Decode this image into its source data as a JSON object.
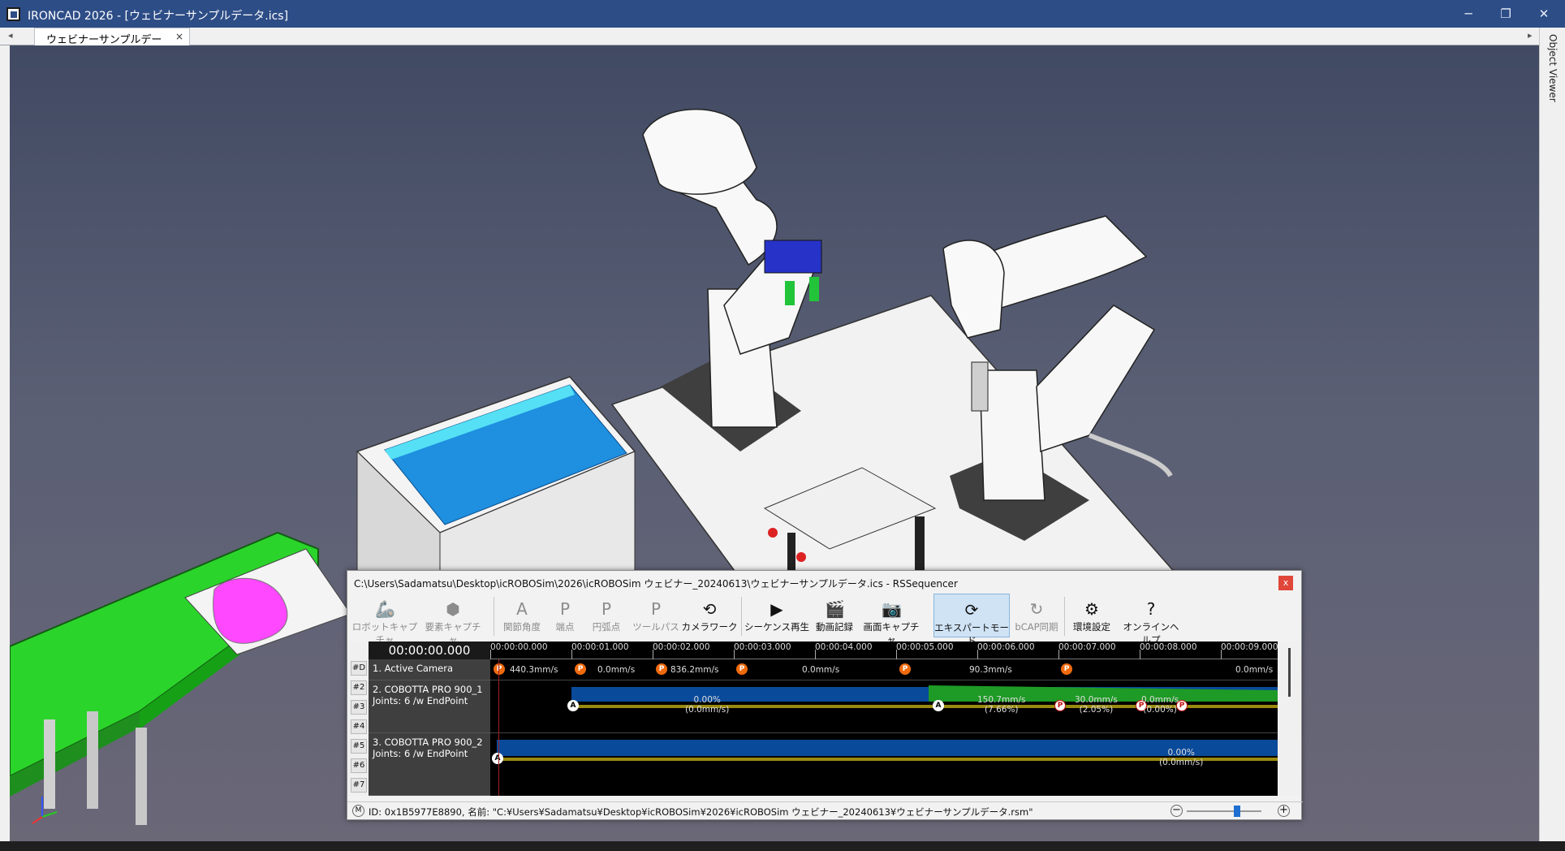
{
  "window": {
    "title": "IRONCAD 2026 - [ウェビナーサンプルデータ.ics]",
    "minimize": "─",
    "restore": "❐",
    "close": "✕"
  },
  "tabs": {
    "doc_tab": "ウェビナーサンプルデータ.ics",
    "close": "×",
    "left_arrow": "◂",
    "right_arrow": "▸"
  },
  "object_viewer": {
    "label": "Object Viewer"
  },
  "sequencer": {
    "path_title": "C:\\Users\\Sadamatsu\\Desktop\\icROBOSim\\2026\\icROBOSim ウェビナー_20240613\\ウェビナーサンプルデータ.ics - RSSequencer",
    "close": "x",
    "toolbar": [
      {
        "label": "ロボットキャプチャ",
        "icon": "robot-capture-icon",
        "disabled": true
      },
      {
        "label": "要素キャプチャ",
        "icon": "element-capture-icon",
        "disabled": true
      },
      {
        "label": "関節角度",
        "icon": "joint-angle-icon",
        "disabled": true
      },
      {
        "label": "端点",
        "icon": "endpoint-icon",
        "disabled": true
      },
      {
        "label": "円弧点",
        "icon": "arc-point-icon",
        "disabled": true
      },
      {
        "label": "ツールパス",
        "icon": "toolpath-icon",
        "disabled": true
      },
      {
        "label": "カメラワーク",
        "icon": "camera-work-icon",
        "disabled": false
      },
      {
        "label": "シーケンス再生",
        "icon": "play-icon",
        "disabled": false
      },
      {
        "label": "動画記録",
        "icon": "clapper-icon",
        "disabled": false
      },
      {
        "label": "画面キャプチャ",
        "icon": "camera-icon",
        "disabled": false
      },
      {
        "label": "エキスパートモード",
        "icon": "expert-mode-icon",
        "disabled": false,
        "active": true
      },
      {
        "label": "bCAP同期",
        "icon": "sync-icon",
        "disabled": true
      },
      {
        "label": "環境設定",
        "icon": "settings-icon",
        "disabled": false
      },
      {
        "label": "オンラインヘルプ",
        "icon": "help-icon",
        "disabled": false
      }
    ],
    "current_time": "00:00:00.000",
    "row_tags": [
      "#D",
      "#2",
      "#3",
      "#4",
      "#5",
      "#6",
      "#7"
    ],
    "tracks": [
      {
        "name": "1.  Active Camera",
        "sub": ""
      },
      {
        "name": "2.  COBOTTA PRO 900_1",
        "sub": "Joints: 6 /w EndPoint"
      },
      {
        "name": "3.  COBOTTA PRO 900_2",
        "sub": "Joints: 6 /w EndPoint"
      }
    ],
    "ruler": [
      "00:00:00.000",
      "00:00:01.000",
      "00:00:02.000",
      "00:00:03.000",
      "00:00:04.000",
      "00:00:05.000",
      "00:00:06.000",
      "00:00:07.000",
      "00:00:08.000",
      "00:00:09.000"
    ],
    "camera_markers": "P",
    "camera_speeds": [
      "440.3mm/s",
      "0.0mm/s",
      "836.2mm/s",
      "0.0mm/s",
      "90.3mm/s",
      "0.0mm/s"
    ],
    "robot1_marker_a": "A",
    "robot1_marker_p": "P",
    "robot1_labels": [
      {
        "l1": "0.00%",
        "l2": "(0.0mm/s)"
      },
      {
        "l1": "150.7mm/s",
        "l2": "(7.66%)"
      },
      {
        "l1": "30.0mm/s",
        "l2": "(2.05%)"
      },
      {
        "l1": "0.0mm/s",
        "l2": "(0.00%)"
      }
    ],
    "robot2_label": {
      "l1": "0.00%",
      "l2": "(0.0mm/s)"
    },
    "status_icon": "M",
    "status_text": "ID: 0x1B5977E8890, 名前: \"C:¥Users¥Sadamatsu¥Desktop¥icROBOSim¥2026¥icROBOSim ウェビナー_20240613¥ウェビナーサンプルデータ.rsm\"",
    "zoom_out": "−",
    "zoom_in": "+"
  },
  "colors": {
    "titlebar": "#2d4d87",
    "marker_orange": "#f06a0c",
    "track_blue": "#0a4a9a",
    "track_green": "#1e9a26",
    "track_olive": "#9a8a10"
  }
}
